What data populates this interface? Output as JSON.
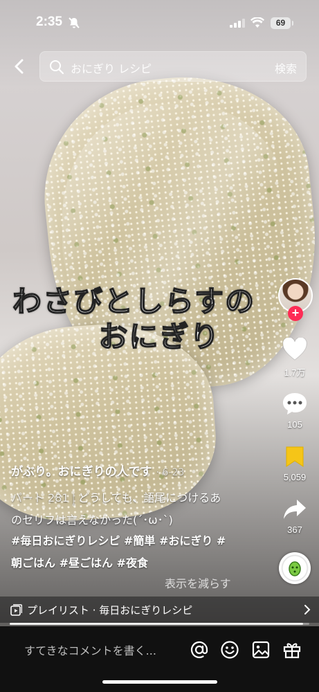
{
  "status_bar": {
    "time": "2:35",
    "battery": "69"
  },
  "search": {
    "placeholder": "おにぎり レシピ",
    "submit_label": "検索"
  },
  "video": {
    "overlay_line1": "わさびとしらすの",
    "overlay_line2": "おにぎり"
  },
  "actions": {
    "likes": "1.7万",
    "comments": "105",
    "saves": "5,059",
    "shares": "367"
  },
  "post": {
    "author": "がぶり。おにぎりの人です",
    "date": "· 6-23",
    "part": "パート 281",
    "description_1": "どうしても、語尾につけるあ",
    "description_2": "のセリフは言えなかった(´･ω･`)",
    "hashtags_1": "#毎日おにぎりレシピ #簡単 #おにぎり #",
    "hashtags_2": "朝ごはん #昼ごはん #夜食",
    "show_less": "表示を減らす"
  },
  "playlist": {
    "label": "プレイリスト · 毎日おにぎりレシピ"
  },
  "progress": {
    "value": 0.98
  },
  "comment_bar": {
    "placeholder": "すてきなコメントを書く..."
  },
  "colors": {
    "follow_accent": "#fe2c55",
    "save_active": "#f5c518"
  },
  "icons": [
    "back-icon",
    "search-icon",
    "heart-icon",
    "comment-icon",
    "bookmark-icon",
    "share-icon",
    "mention-icon",
    "emoji-icon",
    "image-icon",
    "gift-icon",
    "playlist-icon",
    "chevron-right-icon"
  ]
}
